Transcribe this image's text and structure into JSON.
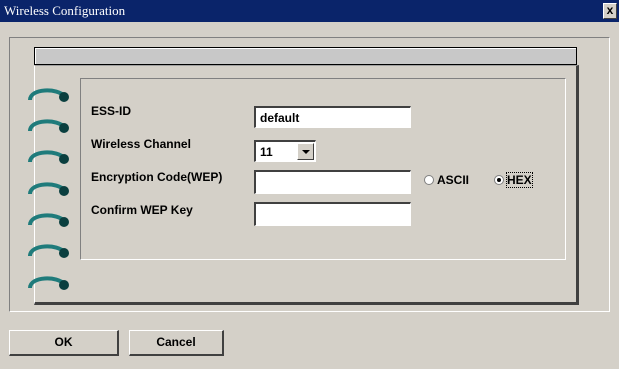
{
  "window": {
    "title": "Wireless Configuration",
    "close_label": "x"
  },
  "form": {
    "ess_id": {
      "label": "ESS-ID",
      "value": "default"
    },
    "channel": {
      "label": "Wireless Channel",
      "value": "11"
    },
    "wep": {
      "label": "Encryption Code(WEP)",
      "value": ""
    },
    "confirm": {
      "label": "Confirm WEP Key",
      "value": ""
    },
    "key_format": {
      "options": [
        "ASCII",
        "HEX"
      ],
      "selected": "HEX"
    }
  },
  "buttons": {
    "ok": "OK",
    "cancel": "Cancel"
  },
  "colors": {
    "titlebar": "#0a246a",
    "dialog_face": "#d4d0c8",
    "ring": "#1f7b7b"
  },
  "icons": {
    "binder_ring": "binder-ring-icon",
    "dropdown": "chevron-down-icon",
    "close": "close-icon"
  }
}
